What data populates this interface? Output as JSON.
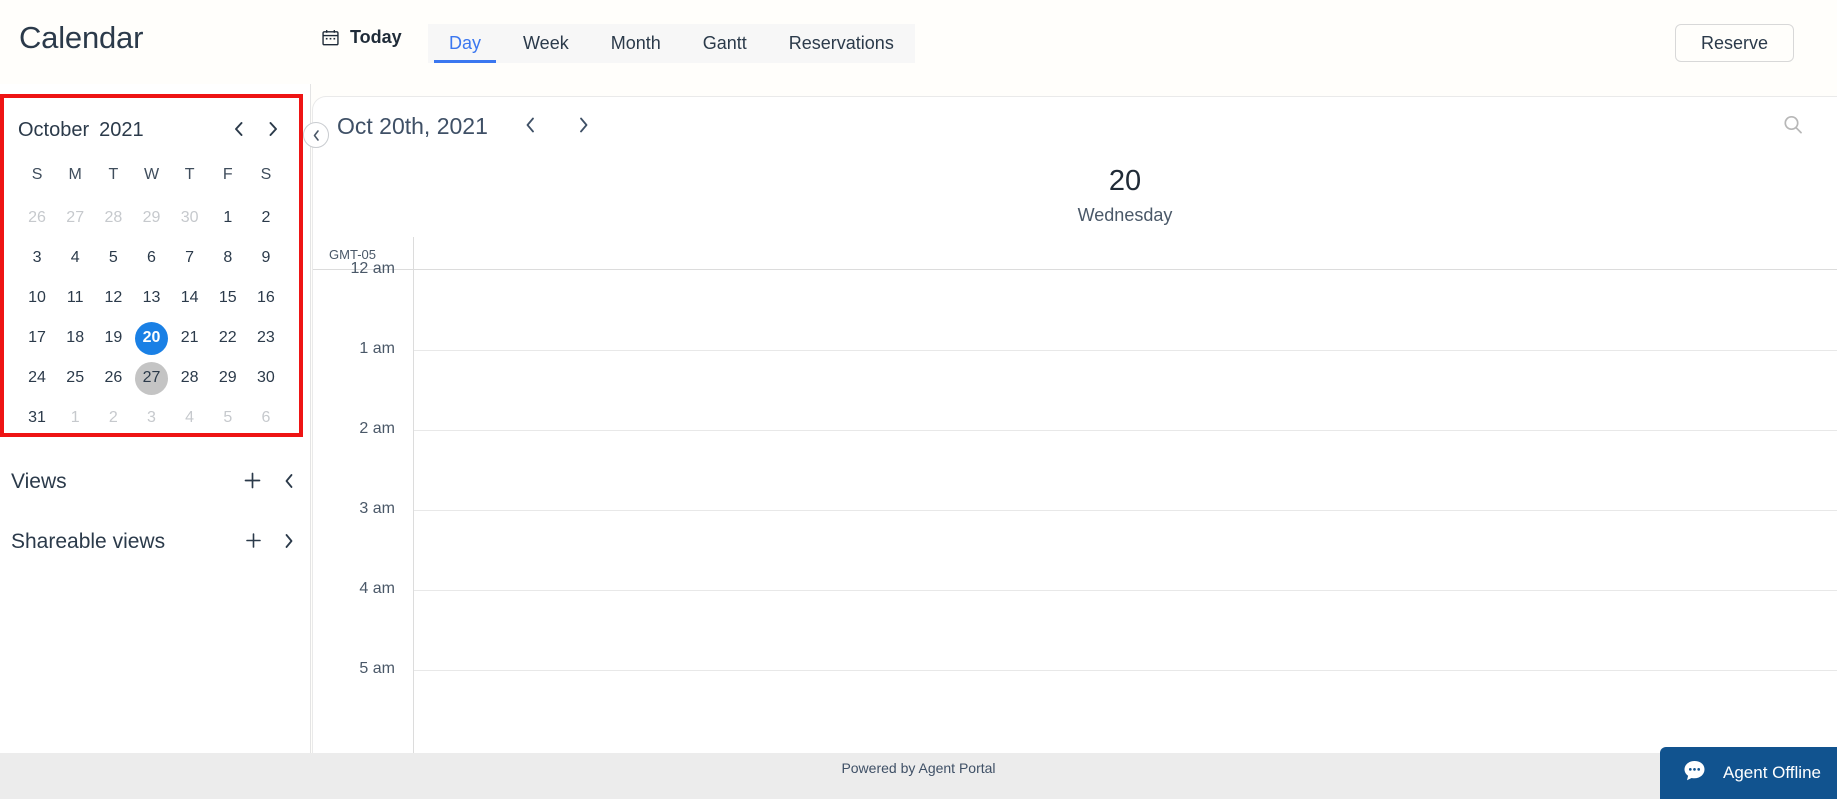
{
  "header": {
    "app_title": "Calendar",
    "today_label": "Today",
    "calendar_icon": "calendar-icon",
    "tabs": [
      {
        "label": "Day",
        "active": true
      },
      {
        "label": "Week",
        "active": false
      },
      {
        "label": "Month",
        "active": false
      },
      {
        "label": "Gantt",
        "active": false
      },
      {
        "label": "Reservations",
        "active": false
      }
    ],
    "reserve_label": "Reserve",
    "accent_color": "#3b77f0"
  },
  "sidebar": {
    "mini_calendar": {
      "month": "October",
      "year": "2021",
      "prev_icon": "chevron-left-icon",
      "next_icon": "chevron-right-icon",
      "day_initials": [
        "S",
        "M",
        "T",
        "W",
        "T",
        "F",
        "S"
      ],
      "selected_day": 20,
      "today_day": 27,
      "selected_color": "#1a80e5",
      "today_color": "#c4c4c4",
      "highlight_border_color": "#ee1414",
      "weeks": [
        [
          {
            "n": "26",
            "muted": true
          },
          {
            "n": "27",
            "muted": true
          },
          {
            "n": "28",
            "muted": true
          },
          {
            "n": "29",
            "muted": true
          },
          {
            "n": "30",
            "muted": true
          },
          {
            "n": "1",
            "muted": false
          },
          {
            "n": "2",
            "muted": false
          }
        ],
        [
          {
            "n": "3",
            "muted": false
          },
          {
            "n": "4",
            "muted": false
          },
          {
            "n": "5",
            "muted": false
          },
          {
            "n": "6",
            "muted": false
          },
          {
            "n": "7",
            "muted": false
          },
          {
            "n": "8",
            "muted": false
          },
          {
            "n": "9",
            "muted": false
          }
        ],
        [
          {
            "n": "10",
            "muted": false
          },
          {
            "n": "11",
            "muted": false
          },
          {
            "n": "12",
            "muted": false
          },
          {
            "n": "13",
            "muted": false
          },
          {
            "n": "14",
            "muted": false
          },
          {
            "n": "15",
            "muted": false
          },
          {
            "n": "16",
            "muted": false
          }
        ],
        [
          {
            "n": "17",
            "muted": false
          },
          {
            "n": "18",
            "muted": false
          },
          {
            "n": "19",
            "muted": false
          },
          {
            "n": "20",
            "muted": false,
            "state": "selected"
          },
          {
            "n": "21",
            "muted": false
          },
          {
            "n": "22",
            "muted": false
          },
          {
            "n": "23",
            "muted": false
          }
        ],
        [
          {
            "n": "24",
            "muted": false
          },
          {
            "n": "25",
            "muted": false
          },
          {
            "n": "26",
            "muted": false
          },
          {
            "n": "27",
            "muted": false,
            "state": "today"
          },
          {
            "n": "28",
            "muted": false
          },
          {
            "n": "29",
            "muted": false
          },
          {
            "n": "30",
            "muted": false
          }
        ],
        [
          {
            "n": "31",
            "muted": false
          },
          {
            "n": "1",
            "muted": true
          },
          {
            "n": "2",
            "muted": true
          },
          {
            "n": "3",
            "muted": true
          },
          {
            "n": "4",
            "muted": true
          },
          {
            "n": "5",
            "muted": true
          },
          {
            "n": "6",
            "muted": true
          }
        ]
      ]
    },
    "views": {
      "label": "Views",
      "add_icon": "plus-icon",
      "collapse_icon": "chevron-left-icon"
    },
    "shareable_views": {
      "label": "Shareable views",
      "add_icon": "plus-icon",
      "expand_icon": "chevron-right-icon"
    }
  },
  "main": {
    "collapse_icon": "chevron-left-circle-icon",
    "date_title": "Oct 20th, 2021",
    "prev_icon": "chevron-left-icon",
    "next_icon": "chevron-right-icon",
    "search_icon": "search-icon",
    "day_number": "20",
    "day_name": "Wednesday",
    "timezone": "GMT-05",
    "hours": [
      "12 am",
      "1 am",
      "2 am",
      "3 am",
      "4 am",
      "5 am"
    ]
  },
  "footer": {
    "text": "Powered by Agent Portal"
  },
  "chat": {
    "icon": "chat-bubble-icon",
    "label": "Agent Offline",
    "background_color": "#11538f"
  }
}
